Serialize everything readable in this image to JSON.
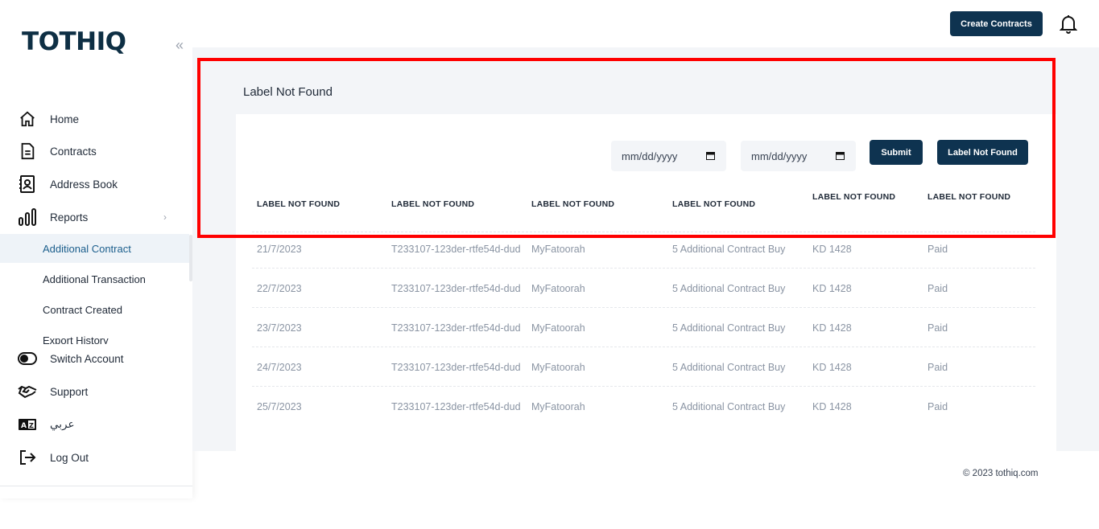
{
  "brand": {
    "logo": "TOTHIQ",
    "collapse_icon": "double-chevron-left-icon"
  },
  "sidebar": {
    "items": [
      {
        "label": "Home",
        "icon": "home-icon"
      },
      {
        "label": "Contracts",
        "icon": "document-icon"
      },
      {
        "label": "Address Book",
        "icon": "address-book-icon"
      },
      {
        "label": "Reports",
        "icon": "bar-chart-icon"
      }
    ],
    "report_sub_items": [
      {
        "label": "Additional Contract",
        "active": true
      },
      {
        "label": "Additional Transaction"
      },
      {
        "label": "Contract Created"
      },
      {
        "label": "Export History"
      }
    ],
    "bottom_items": [
      {
        "label": "Switch Account",
        "icon": "toggle-icon"
      },
      {
        "label": "Support",
        "icon": "handshake-icon"
      },
      {
        "label": "عربي",
        "icon": "language-icon"
      },
      {
        "label": "Log Out",
        "icon": "logout-icon"
      }
    ]
  },
  "header": {
    "create_label": "Create Contracts",
    "bell_icon": "bell-icon"
  },
  "page": {
    "title": "Label Not Found"
  },
  "filters": {
    "date_from_placeholder": "mm/dd/yyyy",
    "date_to_placeholder": "mm/dd/yyyy",
    "submit_label": "Submit",
    "export_label": "Label Not Found"
  },
  "table": {
    "headers": [
      "LABEL NOT FOUND",
      "LABEL NOT FOUND",
      "LABEL NOT FOUND",
      "LABEL NOT FOUND",
      "LABEL NOT FOUND",
      "LABEL NOT FOUND"
    ],
    "rows": [
      [
        "21/7/2023",
        "T233107-123der-rtfe54d-dud",
        "MyFatoorah",
        "5 Additional Contract Buy",
        "KD 1428",
        "Paid"
      ],
      [
        "22/7/2023",
        "T233107-123der-rtfe54d-dud",
        "MyFatoorah",
        "5 Additional Contract Buy",
        "KD 1428",
        "Paid"
      ],
      [
        "23/7/2023",
        "T233107-123der-rtfe54d-dud",
        "MyFatoorah",
        "5 Additional Contract Buy",
        "KD 1428",
        "Paid"
      ],
      [
        "24/7/2023",
        "T233107-123der-rtfe54d-dud",
        "MyFatoorah",
        "5 Additional Contract Buy",
        "KD 1428",
        "Paid"
      ],
      [
        "25/7/2023",
        "T233107-123der-rtfe54d-dud",
        "MyFatoorah",
        "5 Additional Contract Buy",
        "KD 1428",
        "Paid"
      ]
    ]
  },
  "footer": {
    "copyright": "© 2023 tothiq.com"
  },
  "colors": {
    "primary": "#0e3350",
    "active_text": "#1b5e8c",
    "highlight": "#ff0000"
  }
}
